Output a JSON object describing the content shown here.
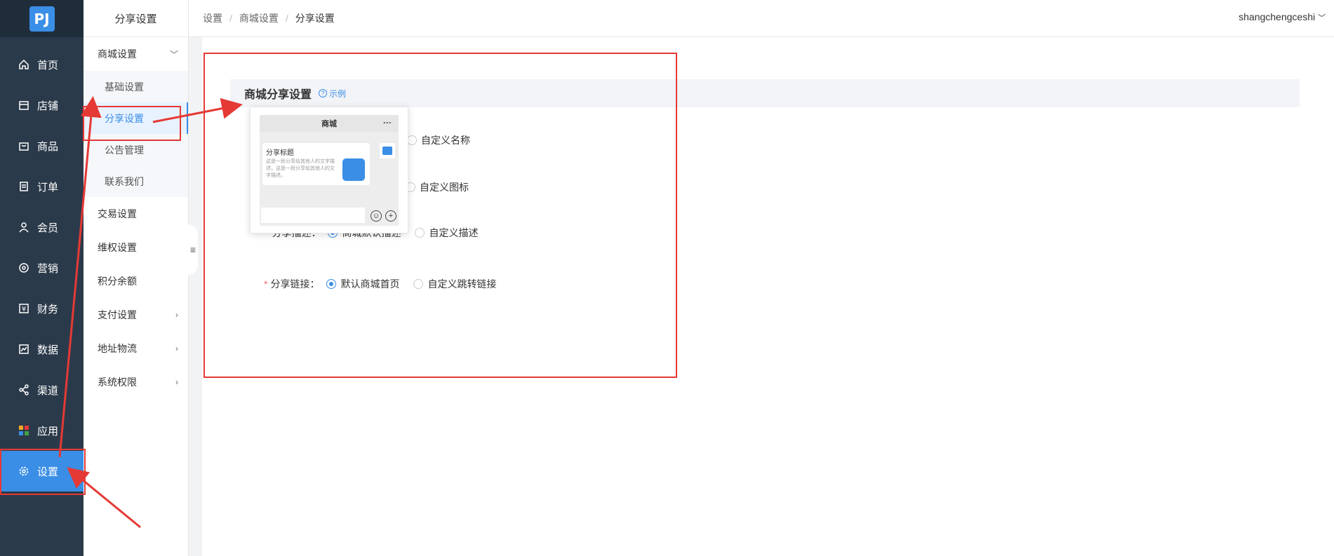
{
  "logo": "PJ",
  "rail": [
    {
      "label": "首页",
      "icon": "home-icon"
    },
    {
      "label": "店铺",
      "icon": "store-icon"
    },
    {
      "label": "商品",
      "icon": "bag-icon"
    },
    {
      "label": "订单",
      "icon": "order-icon"
    },
    {
      "label": "会员",
      "icon": "user-icon"
    },
    {
      "label": "营销",
      "icon": "marketing-icon"
    },
    {
      "label": "财务",
      "icon": "finance-icon"
    },
    {
      "label": "数据",
      "icon": "chart-icon"
    },
    {
      "label": "渠道",
      "icon": "channel-icon"
    },
    {
      "label": "应用",
      "icon": "apps-icon"
    },
    {
      "label": "设置",
      "icon": "gear-icon"
    }
  ],
  "submenu": {
    "title": "分享设置",
    "group_mall": "商城设置",
    "items": [
      "基础设置",
      "分享设置",
      "公告管理",
      "联系我们"
    ],
    "groups": [
      "交易设置",
      "维权设置",
      "积分余额",
      "支付设置",
      "地址物流",
      "系统权限"
    ]
  },
  "breadcrumb": [
    "设置",
    "商城设置",
    "分享设置"
  ],
  "user": "shangchengceshi",
  "section": {
    "title": "商城分享设置",
    "example": "示例"
  },
  "form": {
    "name_option": "自定义名称",
    "icon_option": "自定义图标",
    "desc_label_partial": "分享描述：",
    "desc_default": "商城默认描述",
    "desc_custom": "自定义描述",
    "link_label": "分享链接：",
    "link_default": "默认商城首页",
    "link_custom": "自定义跳转链接"
  },
  "popover": {
    "header": "商城",
    "more": "···",
    "share_title": "分享标题",
    "share_desc": "这是一段分享给其他人的文字描述，这是一段分享给其他人的文字描述。"
  }
}
